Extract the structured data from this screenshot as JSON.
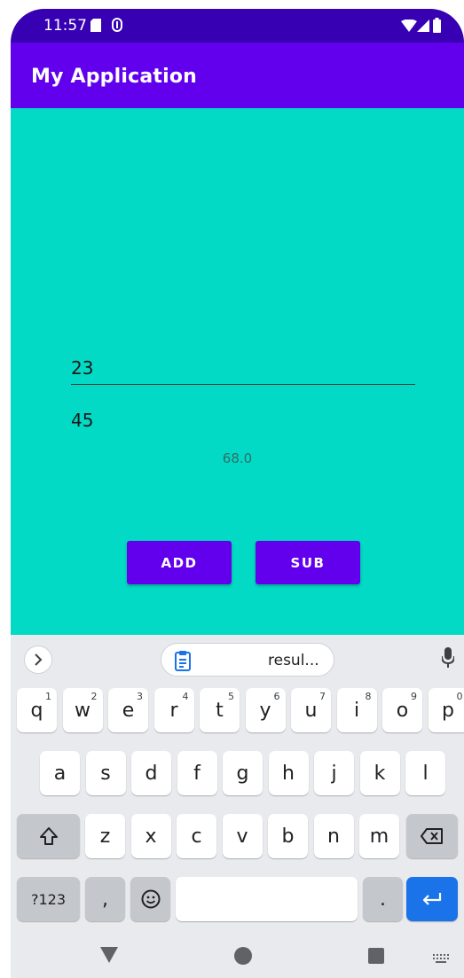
{
  "status_bar": {
    "time": "11:57",
    "icons": [
      "sd-card-icon",
      "sync-icon",
      "wifi-icon",
      "signal-icon",
      "battery-icon"
    ]
  },
  "app_bar": {
    "title": "My Application"
  },
  "form": {
    "first_value": "23",
    "second_value": "45",
    "result": "68.0",
    "add_label": "ADD",
    "sub_label": "SUB"
  },
  "keyboard": {
    "suggestion": "resul...",
    "row1": [
      {
        "label": "q",
        "hint": "1"
      },
      {
        "label": "w",
        "hint": "2"
      },
      {
        "label": "e",
        "hint": "3"
      },
      {
        "label": "r",
        "hint": "4"
      },
      {
        "label": "t",
        "hint": "5"
      },
      {
        "label": "y",
        "hint": "6"
      },
      {
        "label": "u",
        "hint": "7"
      },
      {
        "label": "i",
        "hint": "8"
      },
      {
        "label": "o",
        "hint": "9"
      },
      {
        "label": "p",
        "hint": "0"
      }
    ],
    "row2": [
      "a",
      "s",
      "d",
      "f",
      "g",
      "h",
      "j",
      "k",
      "l"
    ],
    "row3": [
      "z",
      "x",
      "c",
      "v",
      "b",
      "n",
      "m"
    ],
    "symbols_label": "?123",
    "comma_label": ",",
    "period_label": "."
  },
  "colors": {
    "status_bar": "#3700b3",
    "primary": "#6200ee",
    "content_bg": "#03dac5",
    "keyboard_bg": "#e8eaed",
    "enter_key": "#1a73e8"
  }
}
